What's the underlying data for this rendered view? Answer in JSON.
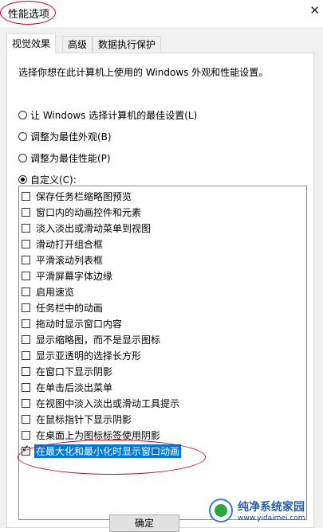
{
  "window": {
    "title": "性能选项",
    "close_glyph": "✕"
  },
  "tabs": [
    {
      "label": "视觉效果",
      "active": true
    },
    {
      "label": "高级",
      "active": false
    },
    {
      "label": "数据执行保护",
      "active": false
    }
  ],
  "description": "选择你想在此计算机上使用的 Windows 外观和性能设置。",
  "radios": [
    {
      "label": "让 Windows 选择计算机的最佳设置(L)",
      "checked": false
    },
    {
      "label": "调整为最佳外观(B)",
      "checked": false
    },
    {
      "label": "调整为最佳性能(P)",
      "checked": false
    },
    {
      "label": "自定义(C):",
      "checked": true
    }
  ],
  "effects": [
    {
      "label": "保存任务栏缩略图预览",
      "checked": false
    },
    {
      "label": "窗口内的动画控件和元素",
      "checked": false
    },
    {
      "label": "淡入淡出或滑动菜单到视图",
      "checked": false
    },
    {
      "label": "滑动打开组合框",
      "checked": false
    },
    {
      "label": "平滑滚动列表框",
      "checked": false
    },
    {
      "label": "平滑屏幕字体边缘",
      "checked": false
    },
    {
      "label": "启用速览",
      "checked": false
    },
    {
      "label": "任务栏中的动画",
      "checked": false
    },
    {
      "label": "拖动时显示窗口内容",
      "checked": false
    },
    {
      "label": "显示缩略图，而不是显示图标",
      "checked": false
    },
    {
      "label": "显示亚透明的选择长方形",
      "checked": false
    },
    {
      "label": "在窗口下显示阴影",
      "checked": false
    },
    {
      "label": "在单击后淡出菜单",
      "checked": false
    },
    {
      "label": "在视图中淡入淡出或滑动工具提示",
      "checked": false
    },
    {
      "label": "在鼠标指针下显示阴影",
      "checked": false
    },
    {
      "label": "在桌面上为图标标签使用阴影",
      "checked": false
    },
    {
      "label": "在最大化和最小化时显示窗口动画",
      "checked": true,
      "selected": true
    }
  ],
  "buttons": {
    "ok_label": "确定"
  },
  "watermark": {
    "name": "纯净系统家园",
    "url": "www.yidaimei.com"
  },
  "colors": {
    "selection": "#0078d7",
    "annotation": "#d0021b"
  }
}
